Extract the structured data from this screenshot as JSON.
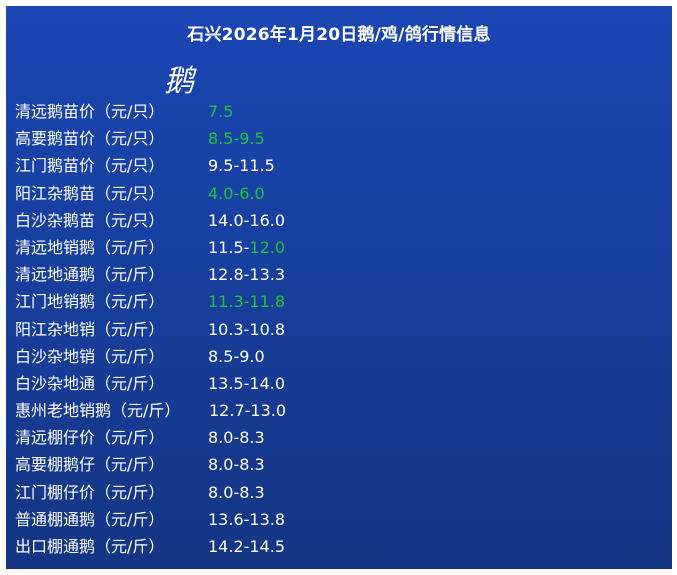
{
  "title": "石兴2026年1月20日鹅/鸡/鸽行情信息",
  "section_heading": "鹅",
  "colors": {
    "background": "#173f9e",
    "text": "#ffffff",
    "highlight_green": "#1fc23a"
  },
  "rows": [
    {
      "label": "清远鹅苗价（元/只）",
      "value_a": "",
      "value_b": "7.5"
    },
    {
      "label": "高要鹅苗价（元/只）",
      "value_a": "",
      "value_b": "8.5-9.5"
    },
    {
      "label": "江门鹅苗价（元/只）",
      "value_a": "9.5-11.5",
      "value_b": ""
    },
    {
      "label": "阳江杂鹅苗（元/只）",
      "value_a": "",
      "value_b": "4.0-6.0"
    },
    {
      "label": "白沙杂鹅苗（元/只）",
      "value_a": "14.0-16.0",
      "value_b": ""
    },
    {
      "label": "清远地销鹅（元/斤）",
      "value_a": "11.5-",
      "value_b": "12.0"
    },
    {
      "label": "清远地通鹅（元/斤）",
      "value_a": "12.8-13.3",
      "value_b": ""
    },
    {
      "label": "江门地销鹅（元/斤）",
      "value_a": "",
      "value_b": "11.3-11.8"
    },
    {
      "label": "阳江杂地销（元/斤）",
      "value_a": "10.3-10.8",
      "value_b": ""
    },
    {
      "label": "白沙杂地销（元/斤）",
      "value_a": "8.5-9.0",
      "value_b": ""
    },
    {
      "label": "白沙杂地通（元/斤）",
      "value_a": "13.5-14.0",
      "value_b": ""
    },
    {
      "label": "惠州老地销鹅（元/斤）",
      "value_a": "12.7-13.0",
      "value_b": ""
    },
    {
      "label": "清远棚仔价（元/斤）",
      "value_a": "8.0-8.3",
      "value_b": ""
    },
    {
      "label": "高要棚鹅仔（元/斤）",
      "value_a": "8.0-8.3",
      "value_b": ""
    },
    {
      "label": "江门棚仔价（元/斤）",
      "value_a": "8.0-8.3",
      "value_b": ""
    },
    {
      "label": "普通棚通鹅（元/斤）",
      "value_a": "13.6-13.8",
      "value_b": ""
    },
    {
      "label": "出口棚通鹅（元/斤）",
      "value_a": "14.2-14.5",
      "value_b": ""
    }
  ]
}
